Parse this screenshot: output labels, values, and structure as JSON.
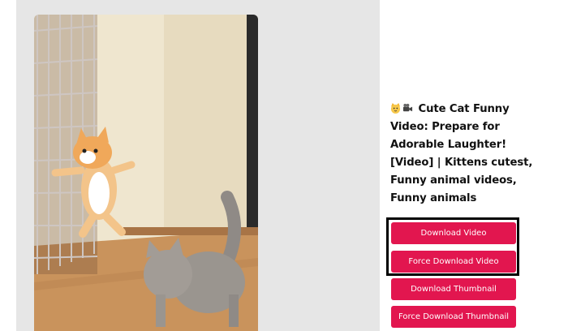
{
  "video": {
    "title": "Cute Cat Funny Video: Prepare for Adorable Laughter! [Video] | Kittens cutest, Funny animal videos, Funny animals",
    "title_lines": [
      "Cute Cat Funny",
      "Video: Prepare for",
      "Adorable Laughter!",
      "[Video] | Kittens cutest,",
      "Funny animal videos,",
      "Funny animals"
    ],
    "title_icons": [
      "cat-face-icon",
      "video-camera-icon"
    ]
  },
  "buttons": {
    "download_video": "Download Video",
    "force_download_video": "Force Download Video",
    "download_thumbnail": "Download Thumbnail",
    "force_download_thumbnail": "Force Download Thumbnail"
  },
  "colors": {
    "button_bg": "#e2164f",
    "panel_bg": "#e6e6e6",
    "highlight_border": "#000000"
  }
}
